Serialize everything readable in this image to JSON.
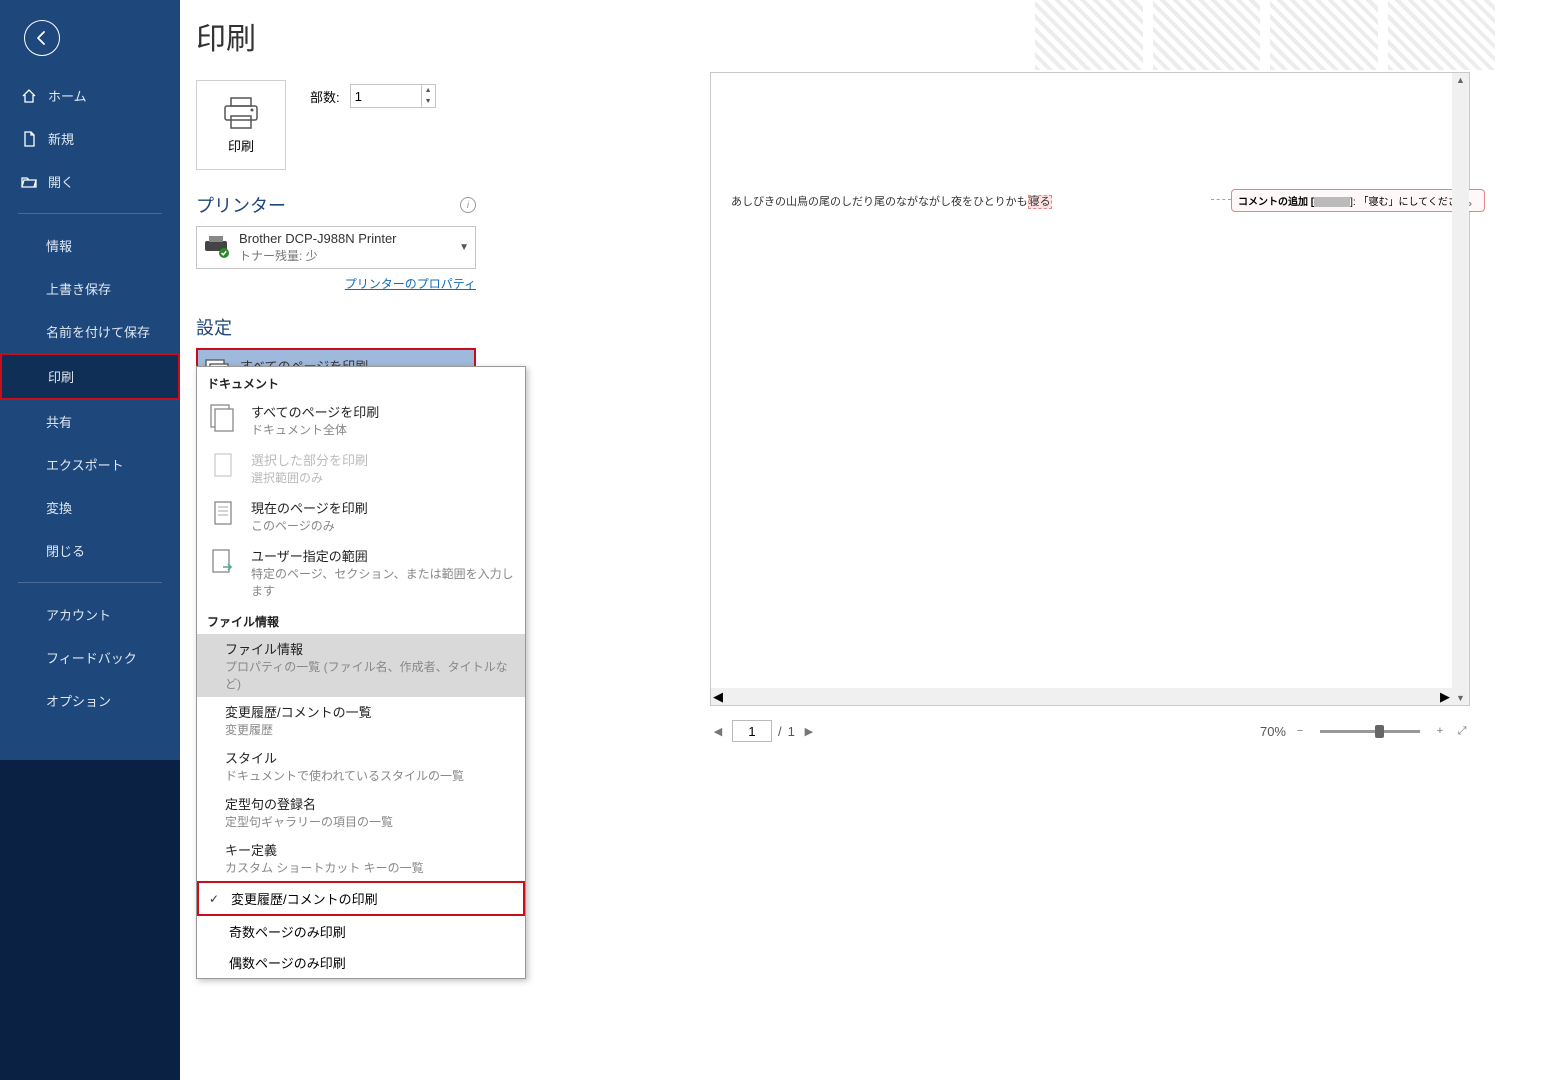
{
  "page_title": "印刷",
  "sidebar": {
    "items_top": [
      {
        "icon": "home",
        "label": "ホーム"
      },
      {
        "icon": "file",
        "label": "新規"
      },
      {
        "icon": "folder-open",
        "label": "開く"
      }
    ],
    "items_mid": [
      "情報",
      "上書き保存",
      "名前を付けて保存",
      "印刷",
      "共有",
      "エクスポート",
      "変換",
      "閉じる"
    ],
    "items_bot": [
      "アカウント",
      "フィードバック",
      "オプション"
    ],
    "selected": "印刷"
  },
  "print_btn_label": "印刷",
  "copies_label": "部数:",
  "copies_value": "1",
  "section_printer": "プリンター",
  "printer": {
    "name": "Brother DCP-J988N Printer",
    "status": "トナー残量: 少"
  },
  "printer_props_link": "プリンターのプロパティ",
  "section_settings": "設定",
  "setting_range": {
    "title": "すべてのページを印刷",
    "sub": "ドキュメント全体"
  },
  "dropdown": {
    "hdr_doc": "ドキュメント",
    "doc_items": [
      {
        "title": "すべてのページを印刷",
        "sub": "ドキュメント全体",
        "icon": "pages"
      },
      {
        "title": "選択した部分を印刷",
        "sub": "選択範囲のみ",
        "icon": "page",
        "disabled": true
      },
      {
        "title": "現在のページを印刷",
        "sub": "このページのみ",
        "icon": "page-lines"
      },
      {
        "title": "ユーザー指定の範囲",
        "sub": "特定のページ、セクション、または範囲を入力します",
        "icon": "page-arrow"
      }
    ],
    "hdr_file": "ファイル情報",
    "file_items": [
      {
        "title": "ファイル情報",
        "sub": "プロパティの一覧 (ファイル名、作成者、タイトルなど)",
        "sel": true
      },
      {
        "title": "変更履歴/コメントの一覧",
        "sub": "変更履歴"
      },
      {
        "title": "スタイル",
        "sub": "ドキュメントで使われているスタイルの一覧"
      },
      {
        "title": "定型句の登録名",
        "sub": "定型句ギャラリーの項目の一覧"
      },
      {
        "title": "キー定義",
        "sub": "カスタム ショートカット キーの一覧"
      }
    ],
    "check_items": [
      {
        "label": "変更履歴/コメントの印刷",
        "checked": true,
        "hl": true
      },
      {
        "label": "奇数ページのみ印刷",
        "checked": false
      },
      {
        "label": "偶数ページのみ印刷",
        "checked": false
      }
    ]
  },
  "preview": {
    "doc_text_pre": "あしびきの山鳥の尾のしだり尾のながながし夜をひとりかも",
    "doc_text_hl": "寝る",
    "comment_label": "コメントの追加 [",
    "comment_tail": "]: 「寝む」にしてください。"
  },
  "footer": {
    "page_current": "1",
    "page_sep": "/",
    "page_total": "1",
    "zoom": "70%"
  }
}
